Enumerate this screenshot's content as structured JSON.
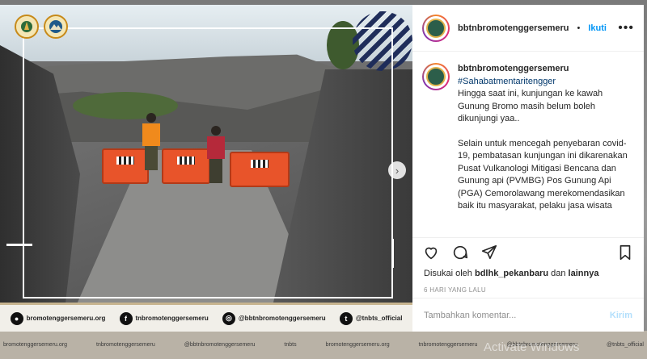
{
  "colors": {
    "accent": "#0095f6",
    "hashtag": "#00376b",
    "barrier": "#e8542a"
  },
  "photo": {
    "logos": [
      "ministry-logo",
      "park-logo"
    ],
    "socials": [
      {
        "icon": "website-icon",
        "glyph": "●",
        "label": "bromotenggersemeru.org"
      },
      {
        "icon": "facebook-icon",
        "glyph": "f",
        "label": "tnbromotenggersemeru"
      },
      {
        "icon": "instagram-icon",
        "glyph": "◎",
        "label": "@bbtnbromotenggersemeru"
      },
      {
        "icon": "twitter-icon",
        "glyph": "t",
        "label": "@tnbts_official"
      }
    ],
    "next_glyph": "›"
  },
  "backdrop": {
    "strip": [
      "bromotenggersemeru.org",
      "tnbromotenggersemeru",
      "@bbtnbromotenggersemeru",
      "tnbts",
      "bromotenggersemeru.org",
      "tnbromotenggersemeru",
      "@bbtnbromotenggersemeru",
      "@tnbts_official"
    ],
    "watermark": "Activate Windows"
  },
  "header": {
    "username": "bbtnbromotenggersemeru",
    "dot": "•",
    "follow": "Ikuti",
    "more": "•••"
  },
  "caption": {
    "username": "bbtnbromotenggersemeru",
    "hashtag": "#Sahabatmentaritengger",
    "para1": "Hingga saat ini, kunjungan ke kawah Gunung Bromo masih belum boleh dikunjungi yaa..",
    "para2": "Selain untuk mencegah penyebaran covid-19, pembatasan kunjungan ini dikarenakan Pusat Vulkanologi Mitigasi Bencana dan Gunung api (PVMBG) Pos Gunung Api (PGA) Cemorolawang merekomendasikan baik itu masyarakat, pelaku jasa wisata"
  },
  "likes": {
    "prefix": "Disukai oleh",
    "user": "bdlhk_pekanbaru",
    "conj": "dan",
    "others": "lainnya"
  },
  "time": "6 HARI YANG LALU",
  "comment": {
    "placeholder": "Tambahkan komentar...",
    "send": "Kirim"
  }
}
